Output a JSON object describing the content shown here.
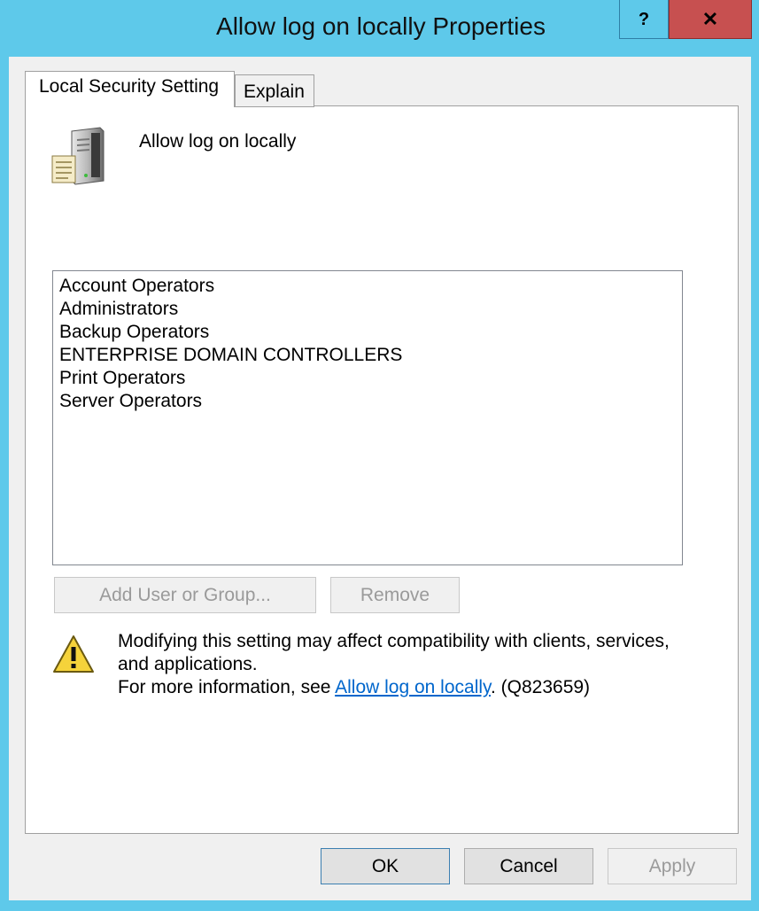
{
  "window": {
    "title": "Allow log on locally Properties",
    "help_glyph": "?",
    "close_glyph": "✕"
  },
  "tabs": [
    {
      "label": "Local Security Setting",
      "active": true
    },
    {
      "label": "Explain",
      "active": false
    }
  ],
  "policy": {
    "name": "Allow log on locally",
    "icon": "policy-server-icon"
  },
  "members": [
    "Account Operators",
    "Administrators",
    "Backup Operators",
    "ENTERPRISE DOMAIN CONTROLLERS",
    "Print Operators",
    "Server Operators"
  ],
  "buttons": {
    "add": "Add User or Group...",
    "remove": "Remove",
    "ok": "OK",
    "cancel": "Cancel",
    "apply": "Apply"
  },
  "warning": {
    "icon": "warning-icon",
    "line1": "Modifying this setting may affect compatibility with clients, services, and applications.",
    "prefix": "For more information, see ",
    "link": "Allow log on locally",
    "suffix": ". (Q823659)"
  },
  "colors": {
    "titlebar": "#5ec9ea",
    "close": "#c75050",
    "link": "#0066cc"
  }
}
